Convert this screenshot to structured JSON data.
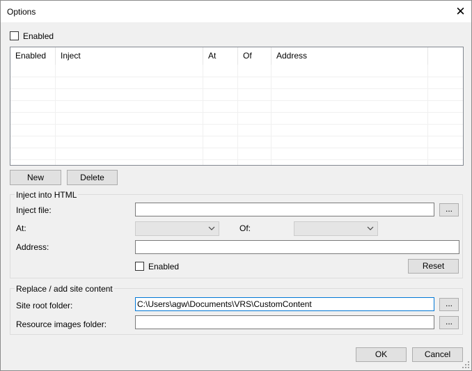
{
  "window": {
    "title": "Options",
    "close_glyph": "✕"
  },
  "top_enabled_label": "Enabled",
  "list": {
    "columns": [
      "Enabled",
      "Inject",
      "At",
      "Of",
      "Address"
    ]
  },
  "buttons": {
    "new": "New",
    "delete": "Delete",
    "browse": "...",
    "reset": "Reset",
    "ok": "OK",
    "cancel": "Cancel"
  },
  "inject_group": {
    "title": "Inject into HTML",
    "inject_file_label": "Inject file:",
    "inject_file_value": "",
    "at_label": "At:",
    "at_value": "",
    "of_label": "Of:",
    "of_value": "",
    "address_label": "Address:",
    "address_value": "",
    "enabled_label": "Enabled"
  },
  "site_group": {
    "title": "Replace / add site content",
    "site_root_label": "Site root folder:",
    "site_root_value": "C:\\Users\\agw\\Documents\\VRS\\CustomContent",
    "resource_images_label": "Resource images folder:",
    "resource_images_value": ""
  },
  "icons": {
    "close": "close-icon",
    "dropdown": "chevron-down-icon",
    "grip": "resize-grip-icon"
  }
}
